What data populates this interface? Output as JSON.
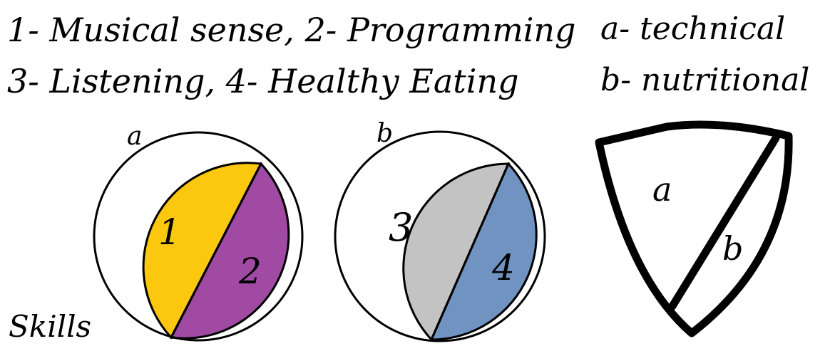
{
  "legend": {
    "line1": "1- Musical sense, 2- Programming",
    "line2": "3- Listening, 4- Healthy Eating",
    "label_a": "a- technical",
    "label_b": "b- nutritional"
  },
  "circles": [
    {
      "label": "a",
      "segments": [
        {
          "label": "1",
          "color": "#FCC70F"
        },
        {
          "label": "2",
          "color": "#A04AA3"
        }
      ]
    },
    {
      "label": "b",
      "segments": [
        {
          "label": "3",
          "color": "#C3C3C3"
        },
        {
          "label": "4",
          "color": "#7093C1"
        }
      ]
    }
  ],
  "shield": {
    "label_a": "a",
    "label_b": "b"
  },
  "footer": {
    "skills": "Skills"
  },
  "colors": {
    "outline": "#000000",
    "background": "#FFFFFF"
  }
}
